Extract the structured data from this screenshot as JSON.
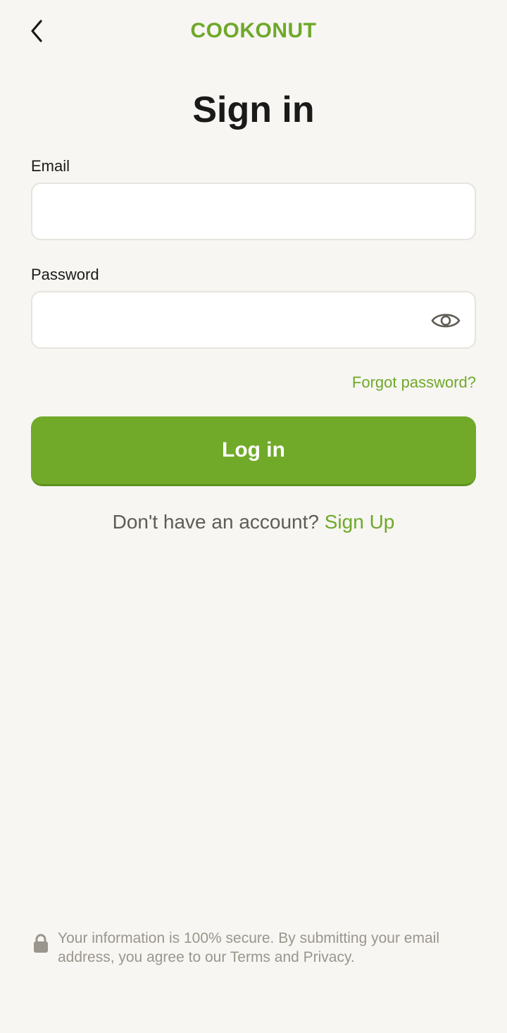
{
  "colors": {
    "brand": "#6fa82a",
    "button": "#71aa29",
    "background": "#f7f6f2"
  },
  "header": {
    "back_icon": "chevron-left-icon",
    "logo_text": "COOKONUT"
  },
  "title": "Sign in",
  "email": {
    "label": "Email",
    "value": "",
    "placeholder": ""
  },
  "password": {
    "label": "Password",
    "value": "",
    "placeholder": "",
    "toggle_icon": "eye-icon"
  },
  "forgot_password": "Forgot password?",
  "login_button": "Log in",
  "signup": {
    "prompt": "Don't have an account?",
    "link": "Sign Up"
  },
  "footer": {
    "icon": "lock-icon",
    "text": "Your information is 100% secure. By submitting your email address, you agree to our Terms and Privacy."
  }
}
